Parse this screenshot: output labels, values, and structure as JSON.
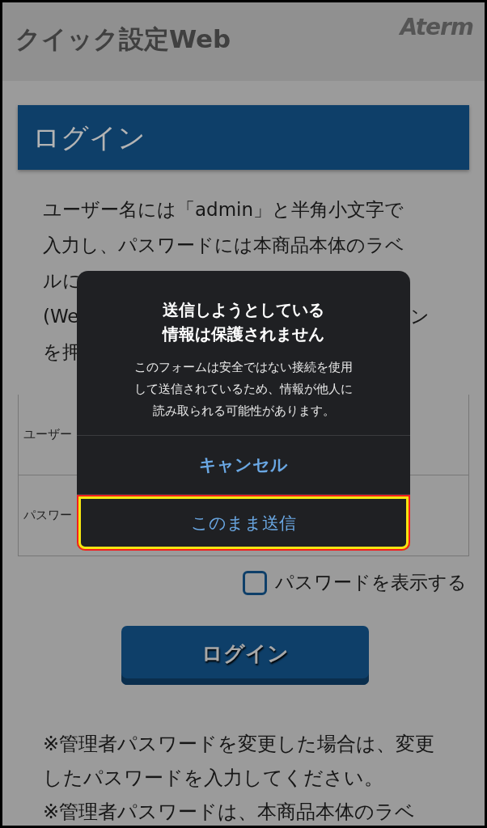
{
  "header": {
    "title": "クイック設定Web",
    "logo": "Aterm"
  },
  "heading": "ログイン",
  "intro_lines": [
    {
      "left": "ユーザー名には「admin」と半角小文字で"
    },
    {
      "left": "入力し、パスワードには本商品本体のラベ"
    },
    {
      "left": "ルに"
    },
    {
      "left": "(We",
      "right": "ン"
    },
    {
      "left": "を押"
    }
  ],
  "form_rows": [
    {
      "label": "ユーザー"
    },
    {
      "label": "パスワー"
    }
  ],
  "show_password": {
    "label": "パスワードを表示する",
    "checked": false
  },
  "login_button": "ログイン",
  "notes": [
    "※管理者パスワードを変更した場合は、変更したパスワードを入力してください。",
    "※管理者パスワードは、本商品本体のラベ"
  ],
  "dialog": {
    "title": "送信しようとしている情報は保護されません",
    "message": "このフォームは安全ではない接続を使用して送信されているため、情報が他人に読み取られる可能性があります。",
    "buttons": [
      {
        "label": "キャンセル",
        "kind": "cancel",
        "highlighted": false
      },
      {
        "label": "このまま送信",
        "kind": "default",
        "highlighted": true
      }
    ]
  }
}
